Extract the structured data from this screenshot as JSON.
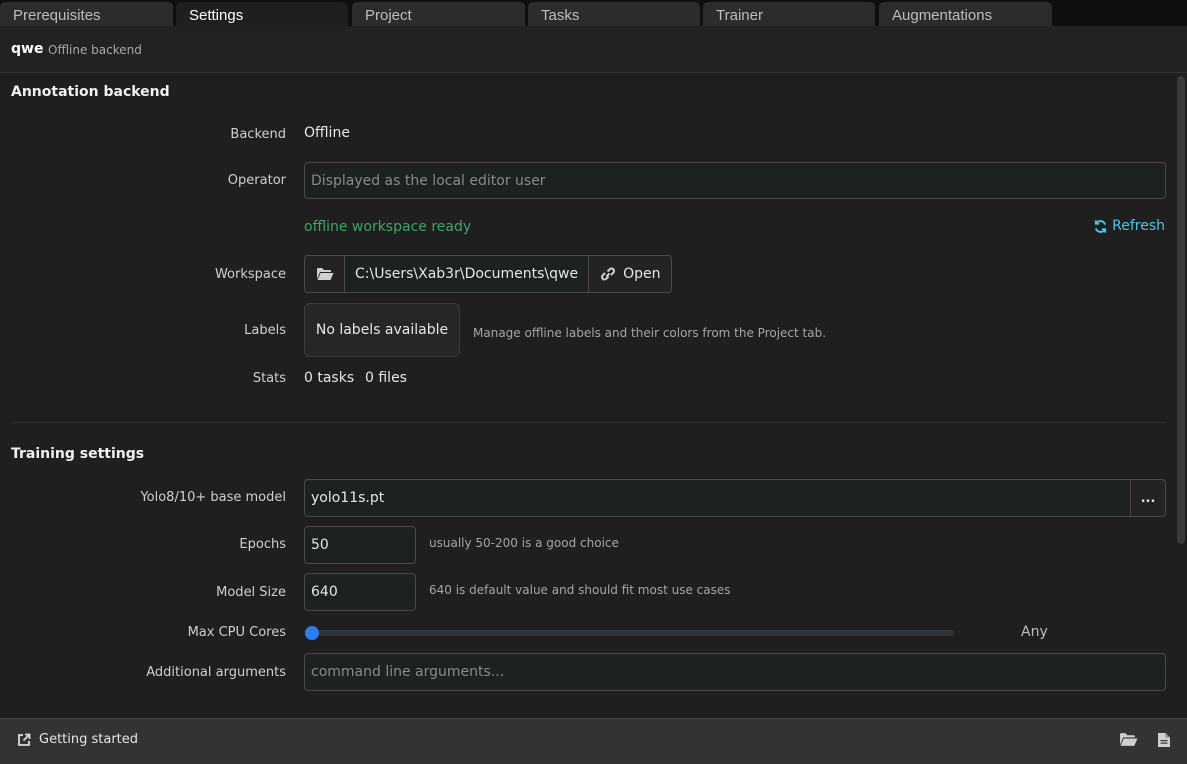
{
  "tabs": [
    {
      "label": "Prerequisites",
      "active": false
    },
    {
      "label": "Settings",
      "active": true
    },
    {
      "label": "Project",
      "active": false
    },
    {
      "label": "Tasks",
      "active": false
    },
    {
      "label": "Trainer",
      "active": false
    },
    {
      "label": "Augmentations",
      "active": false
    }
  ],
  "project": {
    "name": "qwe",
    "backend_note": "Offline backend"
  },
  "annotation": {
    "title": "Annotation backend",
    "backend_label": "Backend",
    "backend_value": "Offline",
    "operator_label": "Operator",
    "operator_placeholder": "Displayed as the local editor user",
    "status_text": "offline workspace ready",
    "refresh_label": "Refresh",
    "workspace_label": "Workspace",
    "workspace_path": "C:\\Users\\Xab3r\\Documents\\qwe",
    "open_label": "Open",
    "labels_label": "Labels",
    "labels_value": "No labels available",
    "labels_hint": "Manage offline labels and their colors from the Project tab.",
    "stats_label": "Stats",
    "stats_tasks": "0 tasks",
    "stats_files": "0 files"
  },
  "training": {
    "title": "Training settings",
    "model_label": "Yolo8/10+ base model",
    "model_value": "yolo11s.pt",
    "model_browse": "...",
    "epochs_label": "Epochs",
    "epochs_value": "50",
    "epochs_hint": "usually 50-200 is a good choice",
    "size_label": "Model Size",
    "size_value": "640",
    "size_hint": "640 is default value and should fit most use cases",
    "cpu_label": "Max CPU Cores",
    "cpu_value_text": "Any",
    "cpu_fraction": 0,
    "args_label": "Additional arguments",
    "args_placeholder": "command line arguments..."
  },
  "footer": {
    "getting_started": "Getting started"
  },
  "colors": {
    "accent": "#4fc3e9",
    "success": "#3fa463",
    "slider": "#2f7df0"
  }
}
